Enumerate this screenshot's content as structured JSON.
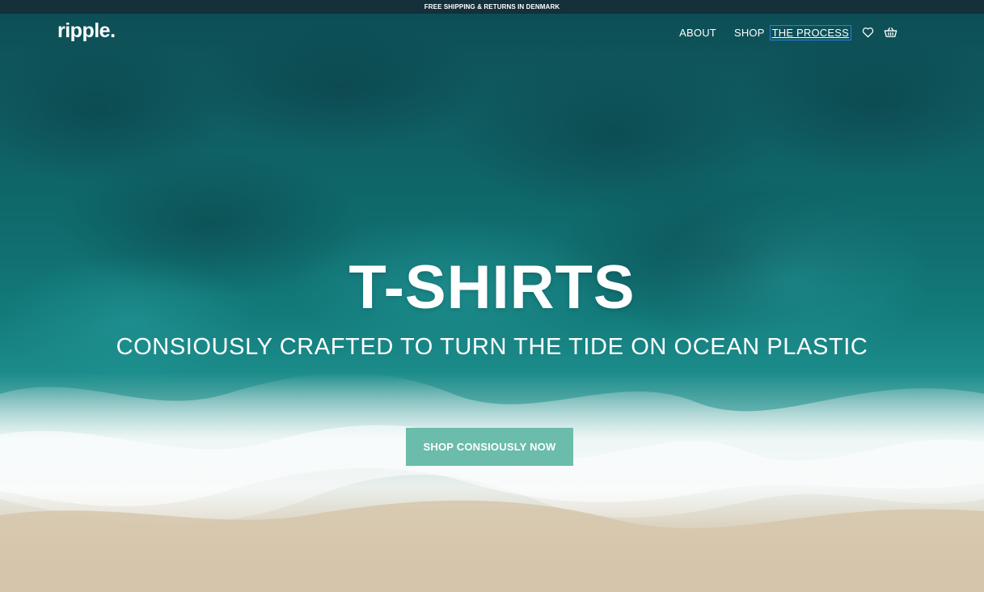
{
  "announcement": {
    "text": "FREE SHIPPING & RETURNS IN DENMARK"
  },
  "header": {
    "logo": "ripple.",
    "nav": [
      {
        "label": "ABOUT"
      },
      {
        "label": "SHOP"
      },
      {
        "label": "THE PROCESS",
        "active": true
      }
    ],
    "icons": [
      "heart-icon",
      "basket-icon"
    ]
  },
  "hero": {
    "title": "T-SHIRTS",
    "subtitle": "CONSIOUSLY CRAFTED TO TURN THE TIDE ON OCEAN PLASTIC",
    "cta_label": "SHOP CONSIOUSLY NOW"
  },
  "colors": {
    "announcement_bg": "#14303a",
    "cta_bg": "#6bbcaa",
    "ocean_deep": "#0d4e55",
    "ocean_mid": "#137a7a",
    "foam": "#e9efec",
    "sand": "#cbb99c",
    "focus_outline": "#2d7fe0"
  }
}
